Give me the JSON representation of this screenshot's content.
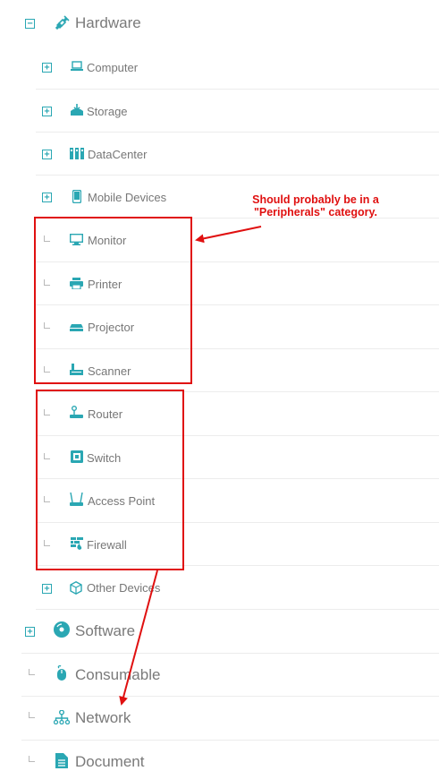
{
  "tree": {
    "hardware": {
      "label": "Hardware",
      "expander": "−"
    },
    "children": [
      {
        "key": "computer",
        "label": "Computer",
        "expander": "+",
        "icon": "laptop-icon"
      },
      {
        "key": "storage",
        "label": "Storage",
        "expander": "+",
        "icon": "storage-icon"
      },
      {
        "key": "datacenter",
        "label": "DataCenter",
        "expander": "+",
        "icon": "datacenter-icon"
      },
      {
        "key": "mobile",
        "label": "Mobile Devices",
        "expander": "+",
        "icon": "mobile-icon"
      },
      {
        "key": "monitor",
        "label": "Monitor",
        "icon": "monitor-icon"
      },
      {
        "key": "printer",
        "label": "Printer",
        "icon": "printer-icon"
      },
      {
        "key": "projector",
        "label": "Projector",
        "icon": "projector-icon"
      },
      {
        "key": "scanner",
        "label": "Scanner",
        "icon": "scanner-icon"
      },
      {
        "key": "router",
        "label": "Router",
        "icon": "router-icon"
      },
      {
        "key": "switch",
        "label": "Switch",
        "icon": "switch-icon"
      },
      {
        "key": "accesspoint",
        "label": "Access Point",
        "icon": "access-point-icon"
      },
      {
        "key": "firewall",
        "label": "Firewall",
        "icon": "firewall-icon"
      },
      {
        "key": "other",
        "label": "Other Devices",
        "expander": "+",
        "icon": "cube-icon"
      }
    ],
    "top_level": [
      {
        "key": "software",
        "label": "Software",
        "expander": "+",
        "icon": "disc-icon"
      },
      {
        "key": "consumable",
        "label": "Consumable",
        "icon": "mouse-icon"
      },
      {
        "key": "network",
        "label": "Network",
        "icon": "network-icon"
      },
      {
        "key": "document",
        "label": "Document",
        "icon": "document-icon"
      }
    ]
  },
  "annotation": {
    "text": "Should probably be in a \"Peripherals\" category."
  },
  "colors": {
    "accent": "#2aa7b3",
    "label": "#777777",
    "annotation": "#e01010"
  }
}
